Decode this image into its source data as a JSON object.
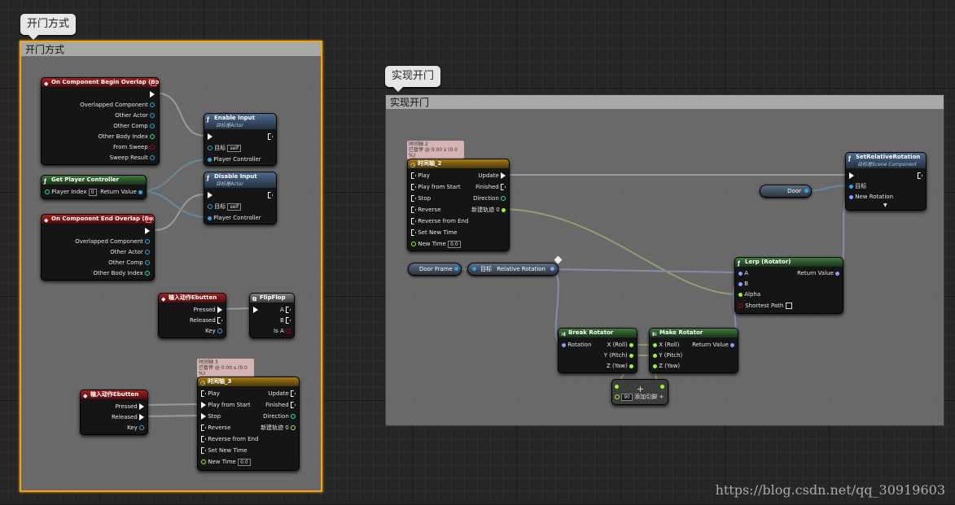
{
  "comments": [
    {
      "title": "开门方式",
      "bubble": "开门方式"
    },
    {
      "title": "实现开门",
      "bubble": "实现开门"
    }
  ],
  "nodes": {
    "overlap_begin": {
      "title": "On Component Begin Overlap (Box)",
      "pins": [
        "Overlapped Component",
        "Other Actor",
        "Other Comp",
        "Other Body Index",
        "From Sweep",
        "Sweep Result"
      ]
    },
    "enable_input": {
      "title": "Enable Input",
      "subtitle": "目标是Actor",
      "target": "目标",
      "target_val": "self",
      "pc": "Player Controller"
    },
    "get_pc": {
      "title": "Get Player Controller",
      "in": "Player Index",
      "in_val": "0",
      "out": "Return Value"
    },
    "disable_input": {
      "title": "Disable Input",
      "subtitle": "目标是Actor",
      "target": "目标",
      "target_val": "self",
      "pc": "Player Controller"
    },
    "overlap_end": {
      "title": "On Component End Overlap (Box)",
      "pins": [
        "Overlapped Component",
        "Other Actor",
        "Other Comp",
        "Other Body Index"
      ]
    },
    "input_e1": {
      "title": "输入动作Ebutten",
      "pins": [
        "Pressed",
        "Released",
        "Key"
      ]
    },
    "flipflop": {
      "title": "FlipFlop",
      "pins": [
        "A",
        "B",
        "Is A"
      ]
    },
    "input_e2": {
      "title": "输入动作Ebutten",
      "pins": [
        "Pressed",
        "Released",
        "Key"
      ]
    },
    "timeline3": {
      "title": "时间轴_3",
      "tag1": "时间轴 3",
      "tag2": "已暂停 @ 0.00 s (0.0 %)",
      "in": [
        "Play",
        "Play from Start",
        "Stop",
        "Reverse",
        "Reverse from End",
        "Set New Time",
        "New Time"
      ],
      "new_time": "0.0",
      "out": [
        "Update",
        "Finished",
        "Direction",
        "新建轨迹 0"
      ]
    },
    "timeline2": {
      "title": "时间轴_2",
      "tag1": "时间轴 2",
      "tag2": "已暂停 @ 0.00 s (0.0 %)",
      "in": [
        "Play",
        "Play from Start",
        "Stop",
        "Reverse",
        "Reverse from End",
        "Set New Time",
        "New Time"
      ],
      "new_time": "0.0",
      "out": [
        "Update",
        "Finished",
        "Direction",
        "新建轨迹 0"
      ]
    },
    "set_rel_rot": {
      "title": "SetRelativeRotation",
      "subtitle": "目标是Scene Component",
      "target": "目标",
      "new_rot": "New Rotation"
    },
    "door": {
      "label": "Door"
    },
    "door_frame": {
      "label": "Door Frame"
    },
    "rel_rot": {
      "target": "目标",
      "out": "Relative Rotation"
    },
    "lerp": {
      "title": "Lerp (Rotator)",
      "in": [
        "A",
        "B",
        "Alpha",
        "Shortest Path"
      ],
      "out": "Return Value"
    },
    "break_rot": {
      "title": "Break Rotator",
      "in": "Rotation",
      "out": [
        "X (Roll)",
        "Y (Pitch)",
        "Z (Yaw)"
      ]
    },
    "make_rot": {
      "title": "Make Rotator",
      "in": [
        "X (Roll)",
        "Y (Pitch)",
        "Z (Yaw)"
      ],
      "out": "Return Value"
    },
    "add_node": {
      "val": "90",
      "label": "添加引脚"
    }
  },
  "watermark": "https://blog.csdn.net/qq_30919603",
  "colors": {
    "exec": "#ffffff",
    "object": "#2fa3e6",
    "struct": "#8c9dff",
    "float": "#9ef03f",
    "bool": "#b5000f",
    "int": "#2de3a8",
    "selected": "#f3a31a"
  }
}
